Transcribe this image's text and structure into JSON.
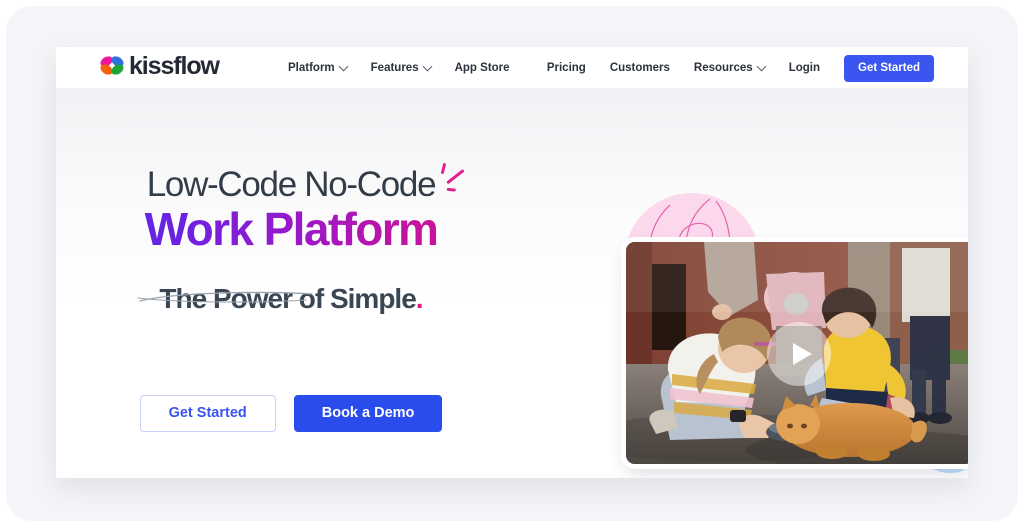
{
  "brand": {
    "wordmark": "kissflow",
    "logo_icon": "kissflow-petals-logo",
    "petal_colors": [
      "#f0159b",
      "#2f6fe0",
      "#f2610c",
      "#1aa534"
    ],
    "accent_blue": "#3a55f0",
    "accent_magenta": "#e1138c"
  },
  "nav": {
    "left_items": [
      {
        "label": "Platform",
        "has_dropdown": true,
        "chevron_icon": "chevron-down-icon"
      },
      {
        "label": "Features",
        "has_dropdown": true,
        "chevron_icon": "chevron-down-icon"
      },
      {
        "label": "App Store",
        "has_dropdown": false
      }
    ],
    "right_items": [
      {
        "label": "Pricing",
        "has_dropdown": false
      },
      {
        "label": "Customers",
        "has_dropdown": false
      },
      {
        "label": "Resources",
        "has_dropdown": true,
        "chevron_icon": "chevron-down-icon"
      },
      {
        "label": "Login",
        "has_dropdown": false
      }
    ],
    "cta_label": "Get Started"
  },
  "hero": {
    "headline_line1": "Low-Code No-Code",
    "headline_line2": "Work Platform",
    "headline_line2_gradient_from": "#4b33f2",
    "headline_line2_gradient_to": "#d9108a",
    "subhead": "The Power of Simple",
    "subhead_dot": ".",
    "sparkle_icon": "sparkle-lines-icon",
    "swoosh_icon": "hand-drawn-underline-swoosh-icon",
    "buttons": [
      {
        "label": "Get Started",
        "style": "outline"
      },
      {
        "label": "Book a Demo",
        "style": "solid"
      }
    ]
  },
  "media": {
    "video_thumbnail_alt": "Two children crouching on pavement feeding a ginger cat from a grey bowl, adults standing behind",
    "play_button_icon": "play-icon",
    "decor_pink_blob": "pink-blob-with-swirl-lines",
    "decor_pink_color": "#fbd8ec",
    "decor_blue_blob": "blue-blob-shape",
    "decor_blue_color": "#bcdcfa"
  }
}
